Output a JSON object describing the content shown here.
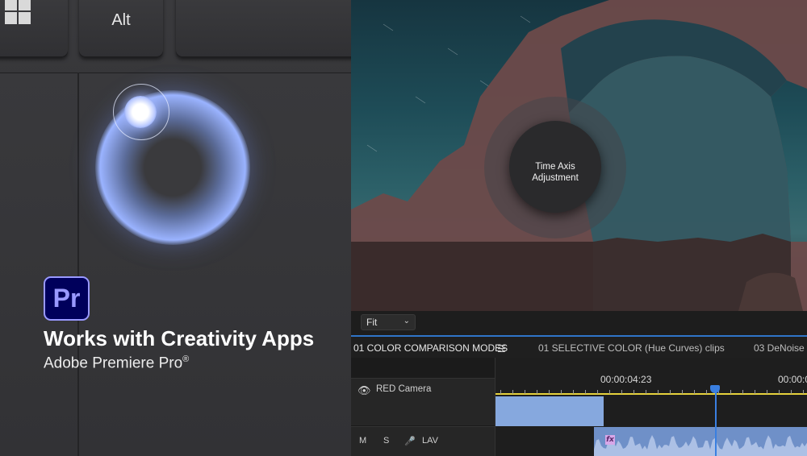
{
  "keyboard": {
    "alt_key_label": "Alt",
    "windows_key_icon": "windows-logo-icon"
  },
  "promo": {
    "app_logo_text": "Pr",
    "headline": "Works with Creativity Apps",
    "subline": "Adobe Premiere Pro",
    "subline_mark": "®"
  },
  "preview": {
    "dial_label_line1": "Time Axis",
    "dial_label_line2": "Adjustment",
    "zoom_select": "Fit"
  },
  "sequence_tabs": [
    {
      "label": "01 COLOR COMPARISON MODES",
      "active": true
    },
    {
      "label": "01 SELECTIVE COLOR (Hue Curves) clips",
      "active": false
    },
    {
      "label": "03 DeNoise D",
      "active": false
    }
  ],
  "timeline": {
    "timecodes": [
      "00:00:04:23",
      "00:00:0"
    ],
    "tracks": {
      "video": {
        "name": "RED Camera"
      },
      "audio": {
        "mute": "M",
        "solo": "S",
        "name": "LAV"
      }
    },
    "fx_badge": "fx"
  },
  "colors": {
    "accent_blue": "#2f75c9",
    "premiere_purple": "#9999ff",
    "premiere_bg": "#00005b",
    "ruler_yellow": "#e6d23c",
    "video_clip": "#86a8de",
    "audio_clip": "#6f90c8"
  }
}
